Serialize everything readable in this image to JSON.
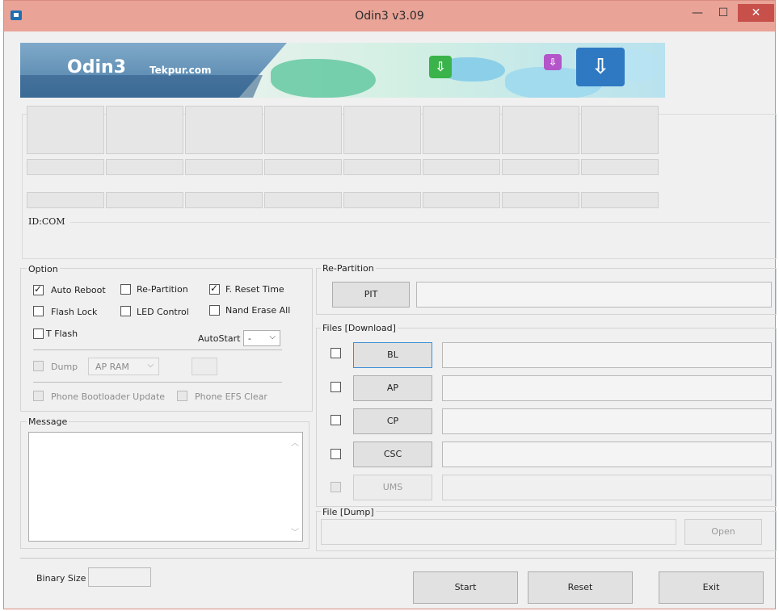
{
  "window": {
    "title": "Odin3 v3.09"
  },
  "controls": {
    "minimize": "—",
    "maximize": "☐",
    "close": "✕"
  },
  "banner": {
    "logo": "Odin3",
    "site": "Tekpur.com"
  },
  "status": {
    "idcom_label": "ID:COM"
  },
  "option": {
    "label": "Option",
    "auto_reboot": "Auto Reboot",
    "re_partition": "Re-Partition",
    "f_reset_time": "F. Reset Time",
    "flash_lock": "Flash Lock",
    "led_control": "LED Control",
    "nand_erase_all": "Nand Erase All",
    "t_flash": "T Flash",
    "autostart_label": "AutoStart",
    "autostart_value": "-",
    "dump": "Dump",
    "dump_target": "AP RAM",
    "phone_bootloader_update": "Phone Bootloader Update",
    "phone_efs_clear": "Phone EFS Clear"
  },
  "message": {
    "label": "Message"
  },
  "repartition": {
    "label": "Re-Partition",
    "pit_button": "PIT"
  },
  "files": {
    "label": "Files [Download]",
    "rows": [
      "BL",
      "AP",
      "CP",
      "CSC",
      "UMS"
    ]
  },
  "file_dump": {
    "label": "File [Dump]",
    "open_button": "Open"
  },
  "bottom": {
    "binary_size_label": "Binary Size",
    "start_button": "Start",
    "reset_button": "Reset",
    "exit_button": "Exit"
  }
}
